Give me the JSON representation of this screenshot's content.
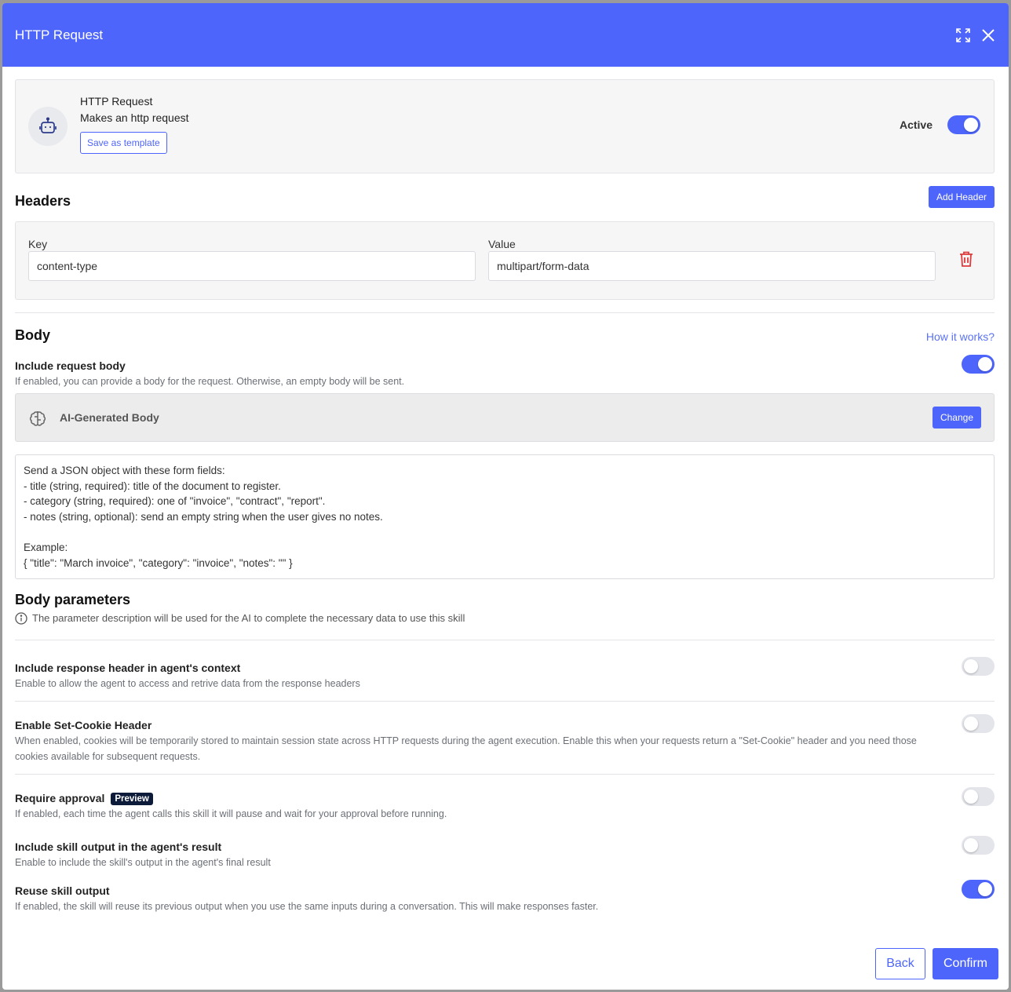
{
  "modal": {
    "title": "HTTP Request",
    "expand_icon": "expand-icon",
    "close_icon": "close-icon"
  },
  "skill": {
    "name": "HTTP Request",
    "description": "Makes an http request",
    "save_template_label": "Save as template",
    "active_label": "Active",
    "active": true,
    "icon": "robot-icon"
  },
  "headers": {
    "title": "Headers",
    "add_label": "Add Header",
    "key_label": "Key",
    "value_label": "Value",
    "rows": [
      {
        "key": "content-type",
        "value": "multipart/form-data"
      }
    ]
  },
  "body": {
    "title": "Body",
    "help_link": "How it works?",
    "include_title": "Include request body",
    "include_desc": "If enabled, you can provide a body for the request. Otherwise, an empty body will be sent.",
    "include_on": true,
    "mode_label": "AI-Generated Body",
    "change_label": "Change",
    "prompt": "Send a JSON object with these form fields:\n- title (string, required): title of the document to register.\n- category (string, required): one of \"invoice\", \"contract\", \"report\".\n- notes (string, optional): send an empty string when the user gives no notes.\n\nExample:\n{ \"title\": \"March invoice\", \"category\": \"invoice\", \"notes\": \"\" }"
  },
  "body_params": {
    "title": "Body parameters",
    "hint": "The parameter description will be used for the AI to complete the necessary data to use this skill"
  },
  "options": [
    {
      "title": "Include response header in agent's context",
      "desc": "Enable to allow the agent to access and retrive data from the response headers",
      "on": false
    },
    {
      "title": "Enable Set-Cookie Header",
      "desc": "When enabled, cookies will be temporarily stored to maintain session state across HTTP requests during the agent execution. Enable this when your requests return a \"Set-Cookie\" header and you need those cookies available for subsequent requests.",
      "on": false
    },
    {
      "title": "Require approval",
      "badge": "Preview",
      "desc": "If enabled, each time the agent calls this skill it will pause and wait for your approval before running.",
      "on": false
    },
    {
      "title": "Include skill output in the agent's result",
      "desc": "Enable to include the skill's output in the agent's final result",
      "on": false
    },
    {
      "title": "Reuse skill output",
      "desc": "If enabled, the skill will reuse its previous output when you use the same inputs during a conversation. This will make responses faster.",
      "on": true
    }
  ],
  "footer": {
    "back_label": "Back",
    "confirm_label": "Confirm"
  },
  "colors": {
    "accent": "#4e65fb",
    "danger": "#e03a3a"
  }
}
